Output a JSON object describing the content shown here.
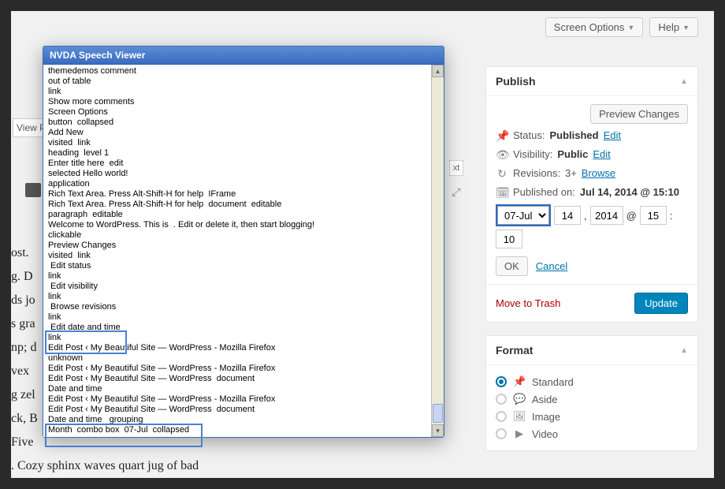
{
  "topbar": {
    "screen_options": "Screen Options",
    "help": "Help"
  },
  "nvda": {
    "title": "NVDA Speech Viewer",
    "lines": [
      "themedemos comment",
      "out of table",
      "link",
      "Show more comments",
      "Screen Options",
      "button  collapsed",
      "Add New",
      "visited  link",
      "heading  level 1",
      "Enter title here  edit",
      "selected Hello world!",
      "application",
      "Rich Text Area. Press Alt-Shift-H for help  IFrame",
      "Rich Text Area. Press Alt-Shift-H for help  document  editable",
      "",
      "paragraph  editable",
      "Welcome to WordPress. This is  . Edit or delete it, then start blogging!",
      "clickable",
      "Preview Changes",
      "visited  link",
      " Edit status",
      "link",
      " Edit visibility",
      "link",
      " Browse revisions",
      "link",
      " Edit date and time",
      "link",
      "Edit Post ‹ My Beautiful Site — WordPress - Mozilla Firefox",
      "unknown",
      "Edit Post ‹ My Beautiful Site — WordPress - Mozilla Firefox",
      "Edit Post ‹ My Beautiful Site — WordPress  document",
      "Date and time",
      "Edit Post ‹ My Beautiful Site — WordPress - Mozilla Firefox",
      "Edit Post ‹ My Beautiful Site — WordPress  document",
      "Date and time   grouping",
      "Month  combo box  07-Jul  collapsed"
    ]
  },
  "left_fragments": [
    "",
    "ost.",
    "g. D",
    "ds jo",
    "s gra",
    "np; d",
    " vex",
    "g zel",
    "",
    "ck, B",
    "Five",
    ". Cozy sphinx waves quart jug of bad"
  ],
  "partials": {
    "viewp": "View P",
    "xt": "xt"
  },
  "publish": {
    "title": "Publish",
    "preview": "Preview Changes",
    "status_label": "Status:",
    "status_value": "Published",
    "visibility_label": "Visibility:",
    "visibility_value": "Public",
    "revisions_label": "Revisions:",
    "revisions_value": "3+",
    "edit": "Edit",
    "browse": "Browse",
    "published_label": "Published on:",
    "published_value": "Jul 14, 2014 @ 15:10",
    "month": "07-Jul",
    "day": "14",
    "year": "2014",
    "hour": "15",
    "minute": "10",
    "ok": "OK",
    "cancel": "Cancel",
    "trash": "Move to Trash",
    "update": "Update"
  },
  "format": {
    "title": "Format",
    "items": [
      "Standard",
      "Aside",
      "Image",
      "Video"
    ],
    "selected": 0
  }
}
